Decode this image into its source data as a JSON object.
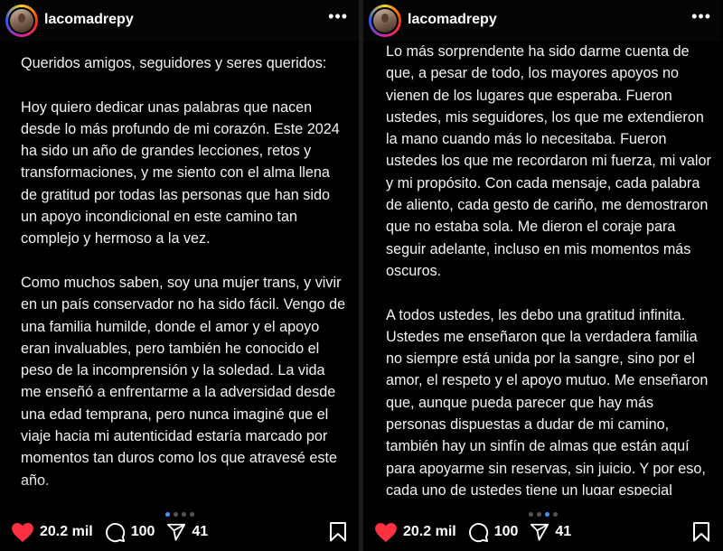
{
  "panels": [
    {
      "username": "lacomadrepy",
      "paragraphs": [
        "Queridos amigos, seguidores y seres queridos:",
        "Hoy quiero dedicar unas palabras que nacen desde lo más profundo de mi corazón. Este 2024 ha sido un año de grandes lecciones, retos y transformaciones, y me siento con el alma llena de gratitud por todas las personas que han sido un apoyo incondicional en este camino tan complejo y hermoso a la vez.",
        "Como muchos saben, soy una mujer trans, y vivir en un país conservador no ha sido fácil. Vengo de una familia humilde, donde el amor y el apoyo eran invaluables, pero también he conocido el peso de la incomprensión y la soledad. La vida me enseñó a enfrentarme a la adversidad desde una edad temprana, pero nunca imaginé que el viaje hacia mi autenticidad estaría marcado por momentos tan duros como los que atravesé este año."
      ],
      "likes": "20.2 mil",
      "comments": "100",
      "shares": "41",
      "active_dot": 0
    },
    {
      "username": "lacomadrepy",
      "paragraphs": [
        "Lo más sorprendente ha sido darme cuenta de que, a pesar de todo, los mayores apoyos no vienen de los lugares que esperaba. Fueron ustedes, mis seguidores, los que me extendieron la mano cuando más lo necesitaba. Fueron ustedes los que me recordaron mi fuerza, mi valor y mi propósito. Con cada mensaje, cada palabra de aliento, cada gesto de cariño, me demostraron que no estaba sola. Me dieron el coraje para seguir adelante, incluso en mis momentos más oscuros.",
        "A todos ustedes, les debo una gratitud infinita. Ustedes me enseñaron que la verdadera familia no siempre está unida por la sangre, sino por el amor, el respeto y el apoyo mutuo. Me enseñaron que, aunque pueda parecer que hay más personas dispuestas a dudar de mi camino, también hay un sinfín de almas que están aquí para apoyarme sin reservas, sin juicio. Y por eso, cada uno de ustedes tiene un lugar especial"
      ],
      "likes": "20.2 mil",
      "comments": "100",
      "shares": "41",
      "active_dot": 2
    }
  ],
  "icons": {
    "avatar": "profile-avatar",
    "more": "more-options-icon",
    "like": "heart-icon",
    "comment": "comment-bubble-icon",
    "share": "send-icon",
    "save": "bookmark-icon"
  },
  "colors": {
    "background": "#000000",
    "text": "#ffffff",
    "like": "#ff3040",
    "active_dot": "#4a90ff"
  }
}
